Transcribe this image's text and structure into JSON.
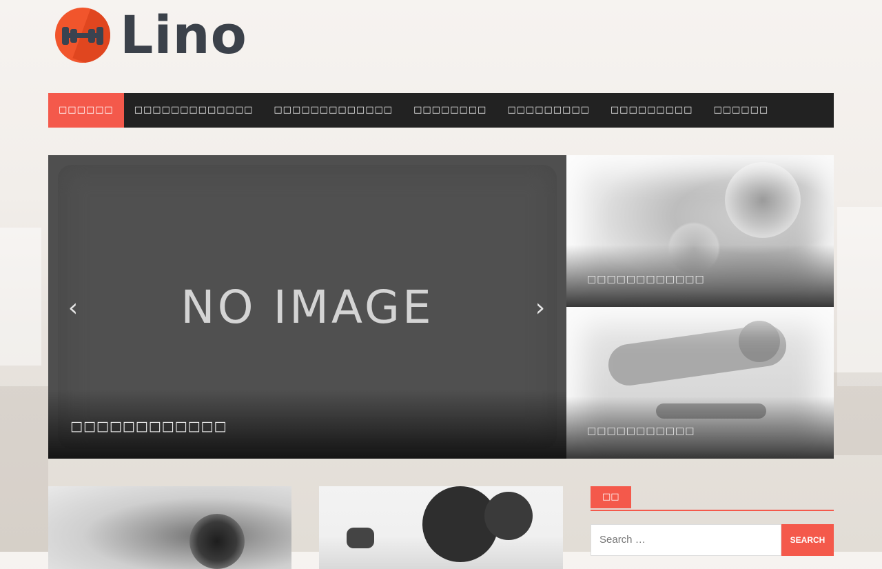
{
  "site": {
    "title": "Lino"
  },
  "nav": {
    "items": [
      {
        "label": "□□□□□□",
        "active": true
      },
      {
        "label": "□□□□□□□□□□□□□",
        "active": false
      },
      {
        "label": "□□□□□□□□□□□□□",
        "active": false
      },
      {
        "label": "□□□□□□□□",
        "active": false
      },
      {
        "label": "□□□□□□□□□",
        "active": false
      },
      {
        "label": "□□□□□□□□□",
        "active": false
      },
      {
        "label": "□□□□□□",
        "active": false
      }
    ]
  },
  "slider": {
    "placeholder_text": "NO IMAGE",
    "caption": "□□□□□□□□□□□□",
    "prev_icon": "chevron-left-icon",
    "next_icon": "chevron-right-icon"
  },
  "featured": [
    {
      "caption": "□□□□□□□□□□□□"
    },
    {
      "caption": "□□□□□□□□□□□"
    }
  ],
  "sidebar": {
    "widget_title": "□□",
    "search": {
      "placeholder": "Search …",
      "button_label": "Search"
    }
  },
  "colors": {
    "accent": "#f4594b",
    "nav_bg": "#222222",
    "logo_orange": "#f1552c",
    "logo_text": "#3b414a"
  }
}
